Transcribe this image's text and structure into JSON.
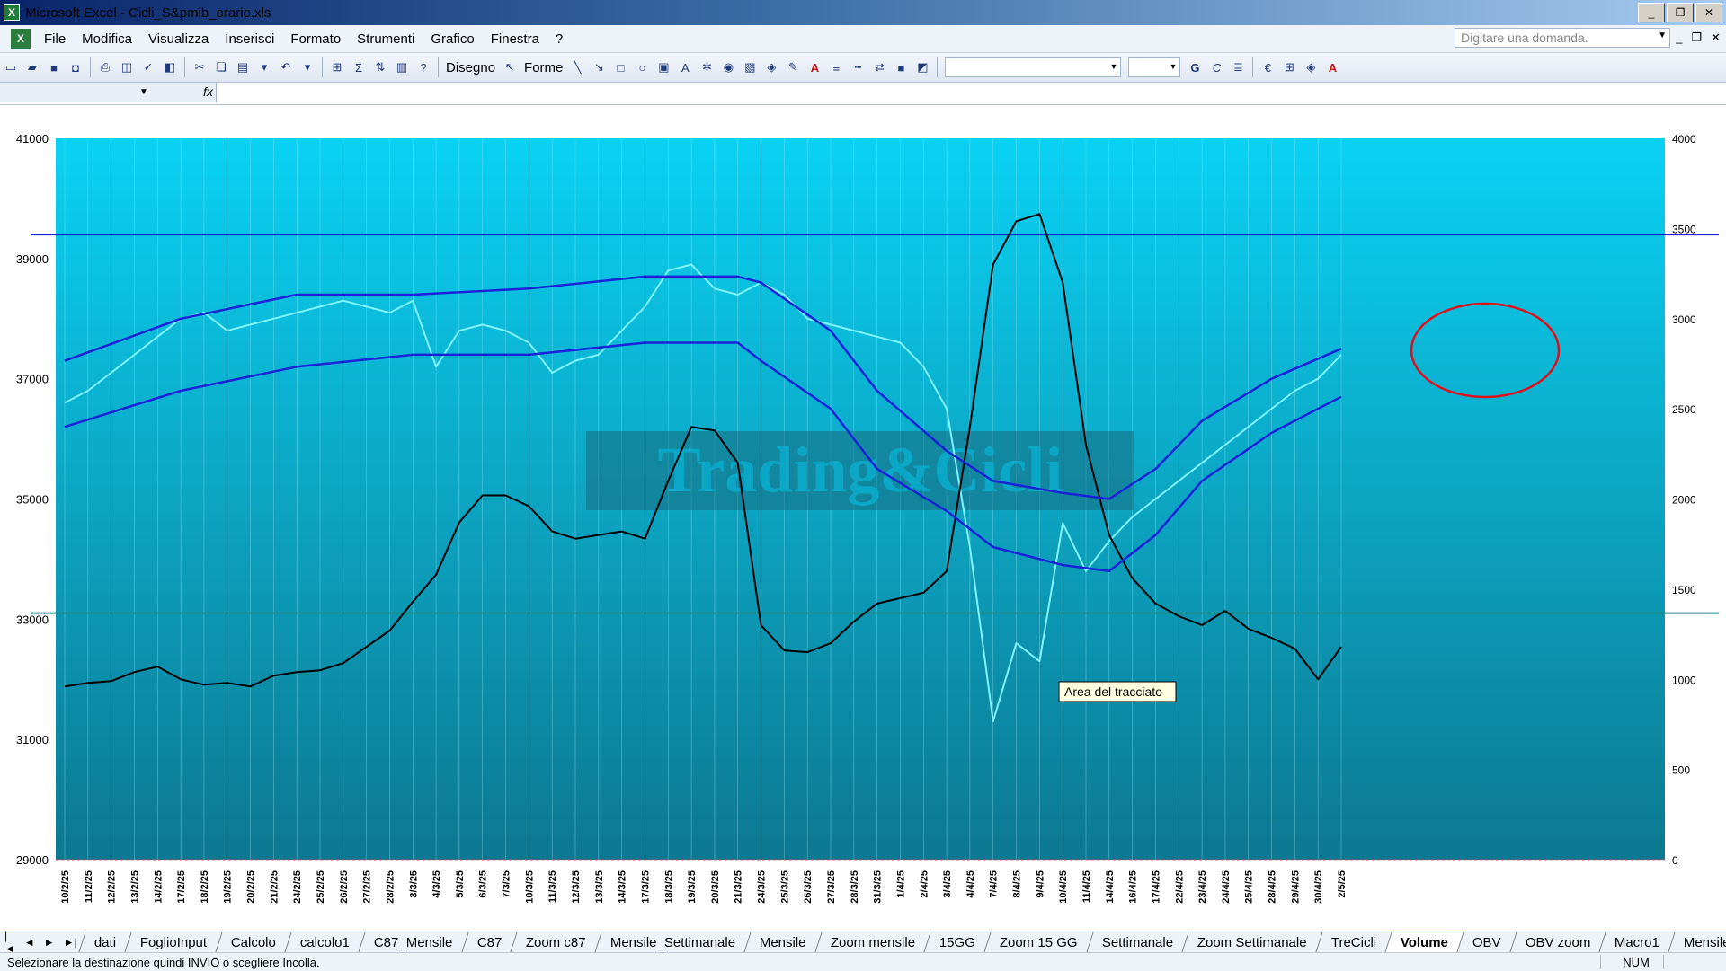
{
  "window": {
    "title": "Microsoft Excel - Cicli_S&pmib_orario.xls",
    "min_label": "_",
    "max_label": "❐",
    "close_label": "✕"
  },
  "menu": {
    "items": [
      "File",
      "Modifica",
      "Visualizza",
      "Inserisci",
      "Formato",
      "Strumenti",
      "Grafico",
      "Finestra",
      "?"
    ],
    "ask_placeholder": "Digitare una domanda."
  },
  "toolbar": {
    "draw_label": "Disegno",
    "shapes_label": "Forme"
  },
  "icons": {
    "app": "excel-icon",
    "new": "new-file-icon",
    "open": "open-folder-icon",
    "save": "save-icon",
    "print": "print-icon",
    "undo": "undo-icon",
    "sum": "sum-icon",
    "fx": "function-icon"
  },
  "chart": {
    "watermark": "Trading&Cicli",
    "tooltip": "Area del tracciato",
    "colors": {
      "plot_top": "#0ad2f4",
      "plot_bottom": "#0d7891",
      "price": "#7ff3ff",
      "volume": "#000000",
      "band": "#1a23d8",
      "mid": "#2a8c96",
      "horizontal_blue": "#1a23d8",
      "horizontal_green": "#1f8c87",
      "circle": "#e0101a"
    }
  },
  "chart_data": {
    "type": "line",
    "title": "",
    "xlabel": "",
    "ylabel": "",
    "grid": true,
    "ylim": [
      29000,
      41000
    ],
    "y2lim": [
      0,
      4000
    ],
    "y_ticks": [
      "41000",
      "39000",
      "37000",
      "35000",
      "33000",
      "31000",
      "29000"
    ],
    "y2_ticks": [
      "4000",
      "3500",
      "3000",
      "2500",
      "2000",
      "1500",
      "1000",
      "500",
      "0"
    ],
    "x_labels": [
      "10/2/25",
      "11/2/25",
      "12/2/25",
      "13/2/25",
      "14/2/25",
      "17/2/25",
      "18/2/25",
      "19/2/25",
      "20/2/25",
      "21/2/25",
      "24/2/25",
      "25/2/25",
      "26/2/25",
      "27/2/25",
      "28/2/25",
      "3/3/25",
      "4/3/25",
      "5/3/25",
      "6/3/25",
      "7/3/25",
      "10/3/25",
      "11/3/25",
      "12/3/25",
      "13/3/25",
      "14/3/25",
      "17/3/25",
      "18/3/25",
      "19/3/25",
      "20/3/25",
      "21/3/25",
      "24/3/25",
      "25/3/25",
      "26/3/25",
      "27/3/25",
      "28/3/25",
      "31/3/25",
      "1/4/25",
      "2/4/25",
      "3/4/25",
      "4/4/25",
      "7/4/25",
      "8/4/25",
      "9/4/25",
      "10/4/25",
      "11/4/25",
      "14/4/25",
      "16/4/25",
      "17/4/25",
      "22/4/25",
      "23/4/25",
      "24/4/25",
      "25/4/25",
      "28/4/25",
      "29/4/25",
      "30/4/25",
      "2/5/25"
    ],
    "horizontal_lines": [
      {
        "axis": "y",
        "value": 39400
      },
      {
        "axis": "y",
        "value": 33100
      }
    ],
    "series": [
      {
        "axis": "y",
        "points": [
          {
            "x": "10/2/25",
            "y": 36600
          },
          {
            "x": "11/2/25",
            "y": 36800
          },
          {
            "x": "12/2/25",
            "y": 37100
          },
          {
            "x": "13/2/25",
            "y": 37400
          },
          {
            "x": "14/2/25",
            "y": 37700
          },
          {
            "x": "17/2/25",
            "y": 38000
          },
          {
            "x": "18/2/25",
            "y": 38100
          },
          {
            "x": "19/2/25",
            "y": 37800
          },
          {
            "x": "20/2/25",
            "y": 37900
          },
          {
            "x": "21/2/25",
            "y": 38000
          },
          {
            "x": "24/2/25",
            "y": 38100
          },
          {
            "x": "25/2/25",
            "y": 38200
          },
          {
            "x": "26/2/25",
            "y": 38300
          },
          {
            "x": "27/2/25",
            "y": 38200
          },
          {
            "x": "28/2/25",
            "y": 38100
          },
          {
            "x": "3/3/25",
            "y": 38300
          },
          {
            "x": "4/3/25",
            "y": 37200
          },
          {
            "x": "5/3/25",
            "y": 37800
          },
          {
            "x": "6/3/25",
            "y": 37900
          },
          {
            "x": "7/3/25",
            "y": 37800
          },
          {
            "x": "10/3/25",
            "y": 37600
          },
          {
            "x": "11/3/25",
            "y": 37100
          },
          {
            "x": "12/3/25",
            "y": 37300
          },
          {
            "x": "13/3/25",
            "y": 37400
          },
          {
            "x": "14/3/25",
            "y": 37800
          },
          {
            "x": "17/3/25",
            "y": 38200
          },
          {
            "x": "18/3/25",
            "y": 38800
          },
          {
            "x": "19/3/25",
            "y": 38900
          },
          {
            "x": "20/3/25",
            "y": 38500
          },
          {
            "x": "21/3/25",
            "y": 38400
          },
          {
            "x": "24/3/25",
            "y": 38600
          },
          {
            "x": "25/3/25",
            "y": 38400
          },
          {
            "x": "26/3/25",
            "y": 38000
          },
          {
            "x": "27/3/25",
            "y": 37900
          },
          {
            "x": "28/3/25",
            "y": 37800
          },
          {
            "x": "31/3/25",
            "y": 37700
          },
          {
            "x": "1/4/25",
            "y": 37600
          },
          {
            "x": "2/4/25",
            "y": 37200
          },
          {
            "x": "3/4/25",
            "y": 36500
          },
          {
            "x": "4/4/25",
            "y": 34200
          },
          {
            "x": "7/4/25",
            "y": 31300
          },
          {
            "x": "8/4/25",
            "y": 32600
          },
          {
            "x": "9/4/25",
            "y": 32300
          },
          {
            "x": "10/4/25",
            "y": 34600
          },
          {
            "x": "11/4/25",
            "y": 33800
          },
          {
            "x": "14/4/25",
            "y": 34300
          },
          {
            "x": "16/4/25",
            "y": 34700
          },
          {
            "x": "17/4/25",
            "y": 35000
          },
          {
            "x": "22/4/25",
            "y": 35300
          },
          {
            "x": "23/4/25",
            "y": 35600
          },
          {
            "x": "24/4/25",
            "y": 35900
          },
          {
            "x": "25/4/25",
            "y": 36200
          },
          {
            "x": "28/4/25",
            "y": 36500
          },
          {
            "x": "29/4/25",
            "y": 36800
          },
          {
            "x": "30/4/25",
            "y": 37000
          },
          {
            "x": "2/5/25",
            "y": 37400
          }
        ]
      },
      {
        "axis": "y2",
        "points": [
          {
            "x": "10/2/25",
            "y": 960
          },
          {
            "x": "11/2/25",
            "y": 980
          },
          {
            "x": "12/2/25",
            "y": 990
          },
          {
            "x": "13/2/25",
            "y": 1040
          },
          {
            "x": "14/2/25",
            "y": 1070
          },
          {
            "x": "17/2/25",
            "y": 1000
          },
          {
            "x": "18/2/25",
            "y": 970
          },
          {
            "x": "19/2/25",
            "y": 980
          },
          {
            "x": "20/2/25",
            "y": 960
          },
          {
            "x": "21/2/25",
            "y": 1020
          },
          {
            "x": "24/2/25",
            "y": 1040
          },
          {
            "x": "25/2/25",
            "y": 1050
          },
          {
            "x": "26/2/25",
            "y": 1090
          },
          {
            "x": "27/2/25",
            "y": 1180
          },
          {
            "x": "28/2/25",
            "y": 1270
          },
          {
            "x": "3/3/25",
            "y": 1430
          },
          {
            "x": "4/3/25",
            "y": 1580
          },
          {
            "x": "5/3/25",
            "y": 1870
          },
          {
            "x": "6/3/25",
            "y": 2020
          },
          {
            "x": "7/3/25",
            "y": 2020
          },
          {
            "x": "10/3/25",
            "y": 1960
          },
          {
            "x": "11/3/25",
            "y": 1820
          },
          {
            "x": "12/3/25",
            "y": 1780
          },
          {
            "x": "13/3/25",
            "y": 1800
          },
          {
            "x": "14/3/25",
            "y": 1820
          },
          {
            "x": "17/3/25",
            "y": 1780
          },
          {
            "x": "18/3/25",
            "y": 2100
          },
          {
            "x": "19/3/25",
            "y": 2400
          },
          {
            "x": "20/3/25",
            "y": 2380
          },
          {
            "x": "21/3/25",
            "y": 2200
          },
          {
            "x": "24/3/25",
            "y": 1300
          },
          {
            "x": "25/3/25",
            "y": 1160
          },
          {
            "x": "26/3/25",
            "y": 1150
          },
          {
            "x": "27/3/25",
            "y": 1200
          },
          {
            "x": "28/3/25",
            "y": 1320
          },
          {
            "x": "31/3/25",
            "y": 1420
          },
          {
            "x": "1/4/25",
            "y": 1450
          },
          {
            "x": "2/4/25",
            "y": 1480
          },
          {
            "x": "3/4/25",
            "y": 1600
          },
          {
            "x": "4/4/25",
            "y": 2400
          },
          {
            "x": "7/4/25",
            "y": 3300
          },
          {
            "x": "8/4/25",
            "y": 3540
          },
          {
            "x": "9/4/25",
            "y": 3580
          },
          {
            "x": "10/4/25",
            "y": 3200
          },
          {
            "x": "11/4/25",
            "y": 2300
          },
          {
            "x": "14/4/25",
            "y": 1800
          },
          {
            "x": "16/4/25",
            "y": 1560
          },
          {
            "x": "17/4/25",
            "y": 1420
          },
          {
            "x": "22/4/25",
            "y": 1350
          },
          {
            "x": "23/4/25",
            "y": 1300
          },
          {
            "x": "24/4/25",
            "y": 1380
          },
          {
            "x": "25/4/25",
            "y": 1280
          },
          {
            "x": "28/4/25",
            "y": 1230
          },
          {
            "x": "29/4/25",
            "y": 1170
          },
          {
            "x": "30/4/25",
            "y": 1000
          },
          {
            "x": "2/5/25",
            "y": 1180
          }
        ]
      },
      {
        "axis": "y",
        "points": [
          {
            "x": "10/2/25",
            "y": 37300
          },
          {
            "x": "17/2/25",
            "y": 38000
          },
          {
            "x": "24/2/25",
            "y": 38400
          },
          {
            "x": "3/3/25",
            "y": 38400
          },
          {
            "x": "10/3/25",
            "y": 38500
          },
          {
            "x": "17/3/25",
            "y": 38700
          },
          {
            "x": "21/3/25",
            "y": 38700
          },
          {
            "x": "24/3/25",
            "y": 38600
          },
          {
            "x": "27/3/25",
            "y": 37800
          },
          {
            "x": "31/3/25",
            "y": 36800
          },
          {
            "x": "3/4/25",
            "y": 35800
          },
          {
            "x": "7/4/25",
            "y": 35300
          },
          {
            "x": "10/4/25",
            "y": 35100
          },
          {
            "x": "14/4/25",
            "y": 35000
          },
          {
            "x": "17/4/25",
            "y": 35500
          },
          {
            "x": "23/4/25",
            "y": 36300
          },
          {
            "x": "28/4/25",
            "y": 37000
          },
          {
            "x": "2/5/25",
            "y": 37500
          }
        ]
      },
      {
        "axis": "y",
        "points": [
          {
            "x": "10/2/25",
            "y": 36200
          },
          {
            "x": "17/2/25",
            "y": 36800
          },
          {
            "x": "24/2/25",
            "y": 37200
          },
          {
            "x": "3/3/25",
            "y": 37400
          },
          {
            "x": "10/3/25",
            "y": 37400
          },
          {
            "x": "17/3/25",
            "y": 37600
          },
          {
            "x": "21/3/25",
            "y": 37600
          },
          {
            "x": "24/3/25",
            "y": 37300
          },
          {
            "x": "27/3/25",
            "y": 36500
          },
          {
            "x": "31/3/25",
            "y": 35500
          },
          {
            "x": "3/4/25",
            "y": 34800
          },
          {
            "x": "7/4/25",
            "y": 34200
          },
          {
            "x": "10/4/25",
            "y": 33900
          },
          {
            "x": "14/4/25",
            "y": 33800
          },
          {
            "x": "17/4/25",
            "y": 34400
          },
          {
            "x": "23/4/25",
            "y": 35300
          },
          {
            "x": "28/4/25",
            "y": 36100
          },
          {
            "x": "2/5/25",
            "y": 36700
          }
        ]
      }
    ]
  },
  "sheet_tabs": [
    "dati",
    "FoglioInput",
    "Calcolo",
    "calcolo1",
    "C87_Mensile",
    "C87",
    "Zoom c87",
    "Mensile_Settimanale",
    "Mensile",
    "Zoom mensile",
    "15GG",
    "Zoom 15 GG",
    "Settimanale",
    "Zoom Settimanale",
    "TreCicli",
    "Volume",
    "OBV",
    "OBV zoom",
    "Macro1",
    "Mensile (2)"
  ],
  "active_tab": "Volume",
  "tab_nav": [
    "|◄",
    "◄",
    "►",
    "►|"
  ],
  "status": {
    "message": "Selezionare la destinazione quindi INVIO o scegliere Incolla.",
    "num": "NUM"
  }
}
